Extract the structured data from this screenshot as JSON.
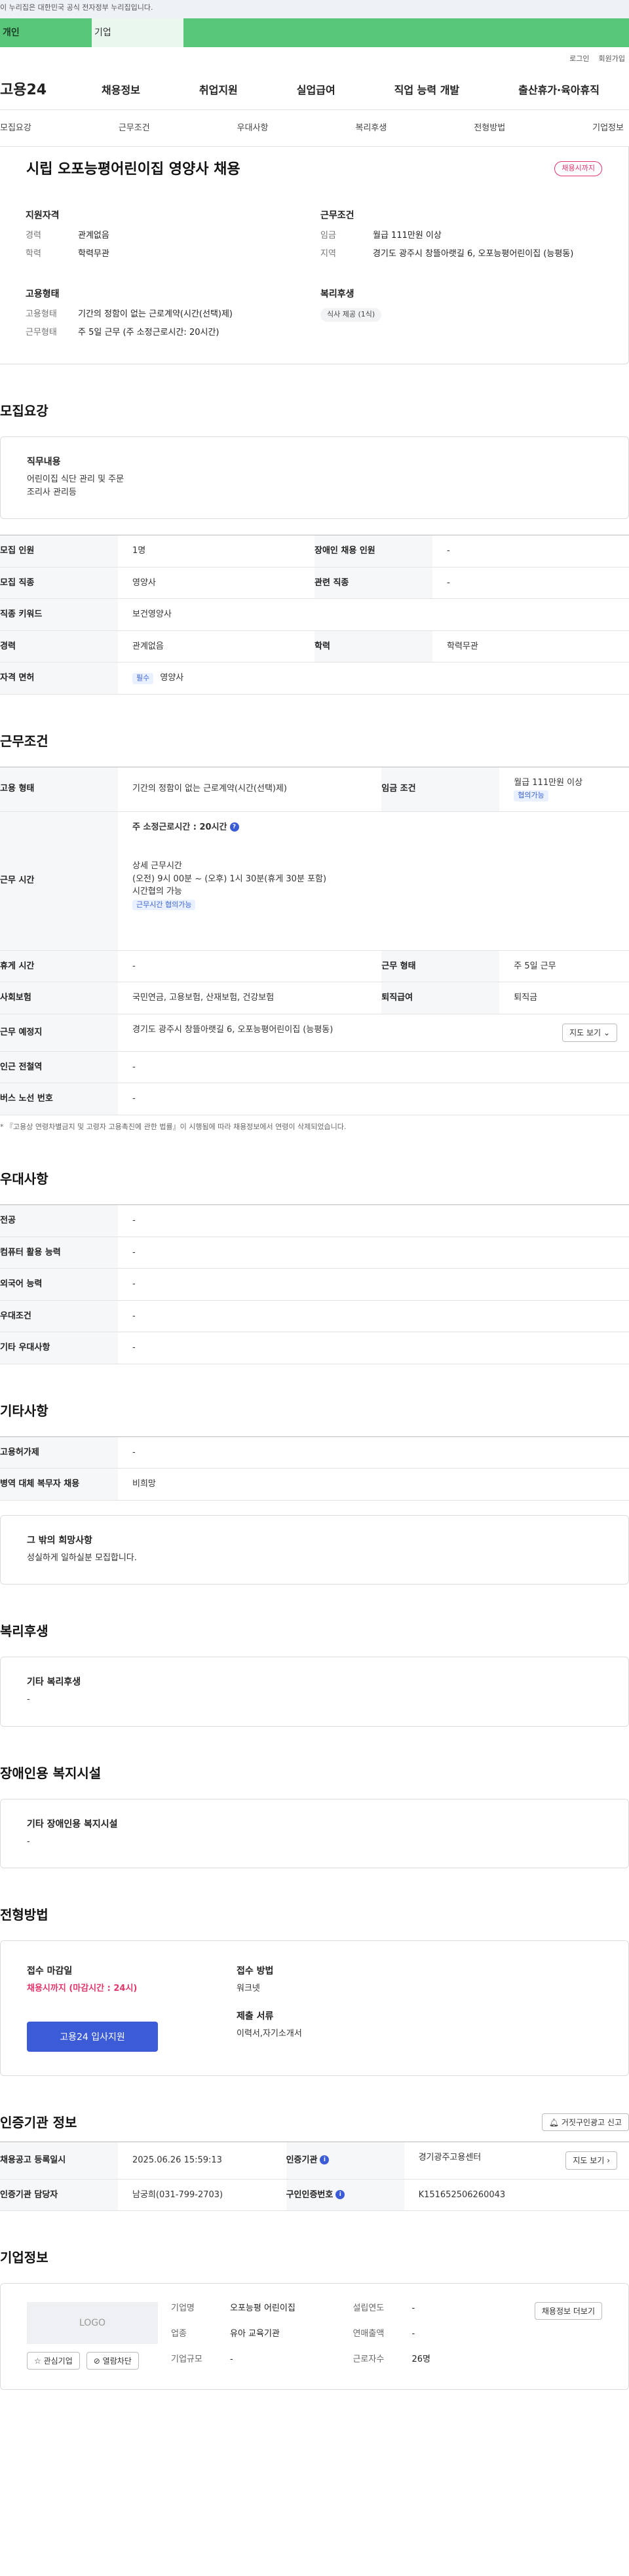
{
  "gov_banner": "이 누리집은 대한민국 공식 전자정부 누리집입니다.",
  "user_tabs": [
    "개인",
    "기업"
  ],
  "util_links": [
    "로그인",
    "회원가입"
  ],
  "logo": "고용24",
  "gnb": [
    "채용정보",
    "취업지원",
    "실업급여",
    "직업 능력 개발",
    "출산휴가·육아휴직"
  ],
  "subnav": [
    "모집요강",
    "근무조건",
    "우대사항",
    "복리후생",
    "전형방법",
    "기업정보"
  ],
  "summary": {
    "title": "시립 오포능평어린이집 영양사 채용",
    "status": "채용시까지",
    "qual_head": "지원자격",
    "qual": [
      {
        "k": "경력",
        "v": "관계없음"
      },
      {
        "k": "학력",
        "v": "학력무관"
      }
    ],
    "cond_head": "근무조건",
    "cond": [
      {
        "k": "임금",
        "v": "월급 111만원 이상"
      },
      {
        "k": "지역",
        "v": "경기도 광주시 창뜰아랫길 6, 오포능평어린이집 (능평동)"
      }
    ],
    "emp_head": "고용형태",
    "emp": [
      {
        "k": "고용형태",
        "v": "기간의 정함이 없는 근로계약(시간(선택)제)"
      },
      {
        "k": "근무형태",
        "v": "주 5일 근무 (주 소정근로시간: 20시간)"
      }
    ],
    "welfare_head": "복리후생",
    "welfare_chip": "식사 제공 (1식)"
  },
  "recruit": {
    "title": "모집요강",
    "duty_label": "직무내용",
    "duty_lines": [
      "어린이집 식단 관리 및 주문",
      "조리사 관리등"
    ],
    "rows": {
      "count_k": "모집 인원",
      "count_v": "1명",
      "disabled_k": "장애인 채용 인원",
      "disabled_v": "-",
      "job_k": "모집 직종",
      "job_v": "영양사",
      "related_k": "관련 직종",
      "related_v": "-",
      "kw_k": "직종 키워드",
      "kw_v": "보건영양사",
      "career_k": "경력",
      "career_v": "관계없음",
      "edu_k": "학력",
      "edu_v": "학력무관",
      "license_k": "자격 면허",
      "license_tag": "필수",
      "license_v": "영양사"
    }
  },
  "work": {
    "title": "근무조건",
    "type_k": "고용 형태",
    "type_v": "기간의 정함이 없는 근로계약(시간(선택)제)",
    "wage_k": "임금 조건",
    "wage_v": "월급 111만원 이상",
    "wage_tag": "협의가능",
    "hours_k": "근무 시간",
    "hours_line1": "주 소정근로시간 : 20시간",
    "hours_detail_head": "상세 근무시간",
    "hours_detail": "(오전) 9시 00분 ~ (오후) 1시 30분(휴게 30분 포함)",
    "hours_flex": "시간협의 가능",
    "hours_tag": "근무시간 협의가능",
    "break_k": "휴게 시간",
    "break_v": "-",
    "form_k": "근무 형태",
    "form_v": "주 5일 근무",
    "insurance_k": "사회보험",
    "insurance_v": "국민연금, 고용보험, 산재보험, 건강보험",
    "severance_k": "퇴직급여",
    "severance_v": "퇴직금",
    "place_k": "근무 예정지",
    "place_v": "경기도 광주시 창뜰아랫길 6, 오포능평어린이집 (능평동)",
    "map_btn": "지도 보기",
    "station_k": "인근 전철역",
    "station_v": "-",
    "bus_k": "버스 노선 번호",
    "bus_v": "-",
    "note": "* 『고용상 연령차별금지 및 고령자 고용촉진에 관한 법률』이 시행됨에 따라 채용정보에서 연령이 삭제되었습니다."
  },
  "preference": {
    "title": "우대사항",
    "rows": [
      {
        "k": "전공",
        "v": "-"
      },
      {
        "k": "컴퓨터 활용 능력",
        "v": "-"
      },
      {
        "k": "외국어 능력",
        "v": "-"
      },
      {
        "k": "우대조건",
        "v": "-"
      },
      {
        "k": "기타 우대사항",
        "v": "-"
      }
    ]
  },
  "other": {
    "title": "기타사항",
    "rows": [
      {
        "k": "고용허가제",
        "v": "-"
      },
      {
        "k": "병역 대체 복무자 채용",
        "v": "비희망"
      }
    ],
    "wish_label": "그 밖의 희망사항",
    "wish_text": "성실하게 일하실분 모집합니다."
  },
  "welfare": {
    "title": "복리후생",
    "label": "기타 복리후생",
    "value": "-"
  },
  "disabled_fac": {
    "title": "장애인용 복지시설",
    "label": "기타 장애인용 복지시설",
    "value": "-"
  },
  "apply": {
    "title": "전형방법",
    "deadline_label": "접수 마감일",
    "deadline_value": "채용시까지 (마감시간 : 24시)",
    "apply_btn": "고용24 입사지원",
    "method_label": "접수 방법",
    "method_value": "워크넷",
    "docs_label": "제출 서류",
    "docs_value": "이력서,자기소개서"
  },
  "cert": {
    "title": "인증기관 정보",
    "report_btn": "거짓구인광고 신고",
    "reg_k": "채용공고 등록일시",
    "reg_v": "2025.06.26 15:59:13",
    "org_k": "인증기관",
    "org_v": "경기광주고용센터",
    "map_btn": "지도 보기",
    "manager_k": "인증기관 담당자",
    "manager_v": "남궁희(031-799-2703)",
    "no_k": "구인인증번호",
    "no_v": "K151652506260043"
  },
  "company": {
    "title": "기업정보",
    "logo": "LOGO",
    "fav_btn": "관심기업",
    "block_btn": "열람차단",
    "name_k": "기업명",
    "name_v": "오포능평 어린이집",
    "industry_k": "업종",
    "industry_v": "유아 교육기관",
    "size_k": "기업규모",
    "size_v": "-",
    "year_k": "설립연도",
    "year_v": "-",
    "sales_k": "연매출액",
    "sales_v": "-",
    "staff_k": "근로자수",
    "staff_v": "26명",
    "more_btn": "채용정보 더보기"
  }
}
